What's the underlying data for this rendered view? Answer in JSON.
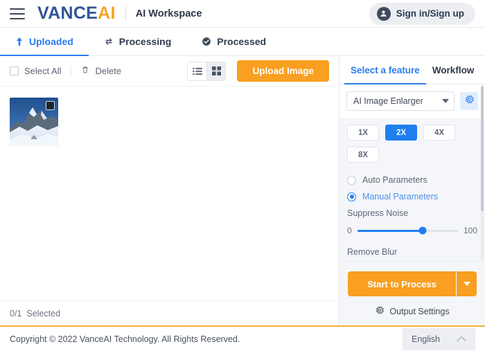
{
  "topbar": {
    "menu_icon": "hamburger-icon",
    "logo_primary": "VANCE",
    "logo_accent": "AI",
    "workspace_title": "AI Workspace",
    "signin_label": "Sign in/Sign up",
    "avatar_icon": "user-avatar-icon"
  },
  "tabs": [
    {
      "label": "Uploaded",
      "icon": "upload-arrow-icon",
      "active": true
    },
    {
      "label": "Processing",
      "icon": "refresh-cycle-icon",
      "active": false
    },
    {
      "label": "Processed",
      "icon": "check-circle-icon",
      "active": false
    }
  ],
  "toolbar": {
    "select_all_label": "Select All",
    "delete_label": "Delete",
    "delete_icon": "trash-icon",
    "list_view_icon": "list-view-icon",
    "grid_view_icon": "grid-view-icon",
    "active_view": "grid",
    "upload_label": "Upload Image"
  },
  "gallery": {
    "items": [
      {
        "name": "mountain-thumbnail",
        "selected": false
      }
    ]
  },
  "status": {
    "selected_count": "0/1",
    "selected_label": "Selected"
  },
  "panel": {
    "tabs": [
      {
        "label": "Select a feature",
        "active": true
      },
      {
        "label": "Workflow",
        "active": false
      }
    ],
    "feature_select": {
      "value": "AI Image Enlarger",
      "caret_icon": "chevron-down-icon"
    },
    "gear_icon": "gear-icon",
    "scale_options": [
      {
        "label": "1X",
        "active": false
      },
      {
        "label": "2X",
        "active": true
      },
      {
        "label": "4X",
        "active": false
      },
      {
        "label": "8X",
        "active": false
      }
    ],
    "parameter_modes": [
      {
        "label": "Auto Parameters",
        "selected": false
      },
      {
        "label": "Manual Parameters",
        "selected": true
      }
    ],
    "sliders": [
      {
        "title": "Suppress Noise",
        "min": "0",
        "max": "100",
        "percent": 65
      }
    ],
    "next_setting_label": "Remove Blur",
    "process_label": "Start to Process",
    "process_caret_icon": "chevron-down-icon",
    "output_settings_label": "Output Settings",
    "output_settings_icon": "gear-icon"
  },
  "footer": {
    "copyright": "Copyright © 2022 VanceAI Technology. All Rights Reserved.",
    "language": "English",
    "language_caret_icon": "chevron-up-icon"
  },
  "colors": {
    "brand_blue": "#2f5597",
    "brand_orange": "#f5a623",
    "accent_blue": "#2a7af0",
    "action_orange": "#f99f21",
    "panel_bg": "#f5f6fa"
  }
}
